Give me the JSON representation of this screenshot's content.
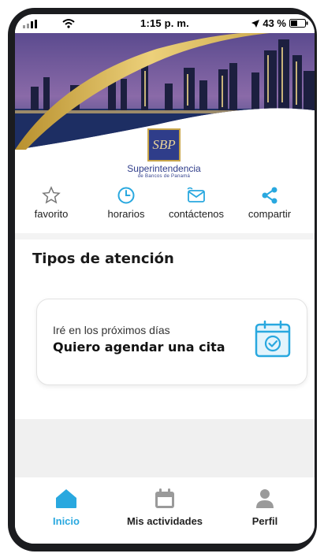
{
  "status_bar": {
    "time": "1:15 p. m.",
    "battery": "43 %"
  },
  "logo": {
    "initials": "SBP",
    "name": "Superintendencia",
    "subtitle": "de Bancos de Panamá"
  },
  "actions": [
    {
      "label": "favorito",
      "icon": "star-icon"
    },
    {
      "label": "horarios",
      "icon": "clock-icon"
    },
    {
      "label": "contáctenos",
      "icon": "mail-icon"
    },
    {
      "label": "compartir",
      "icon": "share-icon"
    }
  ],
  "section": {
    "title": "Tipos de atención"
  },
  "card": {
    "small": "Iré en los próximos días",
    "title": "Quiero agendar una cita",
    "icon": "calendar-check-icon"
  },
  "tabs": [
    {
      "label": "Inicio",
      "icon": "home-icon",
      "active": true
    },
    {
      "label": "Mis actividades",
      "icon": "calendar-icon",
      "active": false
    },
    {
      "label": "Perfil",
      "icon": "user-icon",
      "active": false
    }
  ],
  "colors": {
    "accent": "#29a8df",
    "brand_navy": "#2f3d8a",
    "gold": "#c9a64a",
    "inactive": "#9a9a9a"
  }
}
